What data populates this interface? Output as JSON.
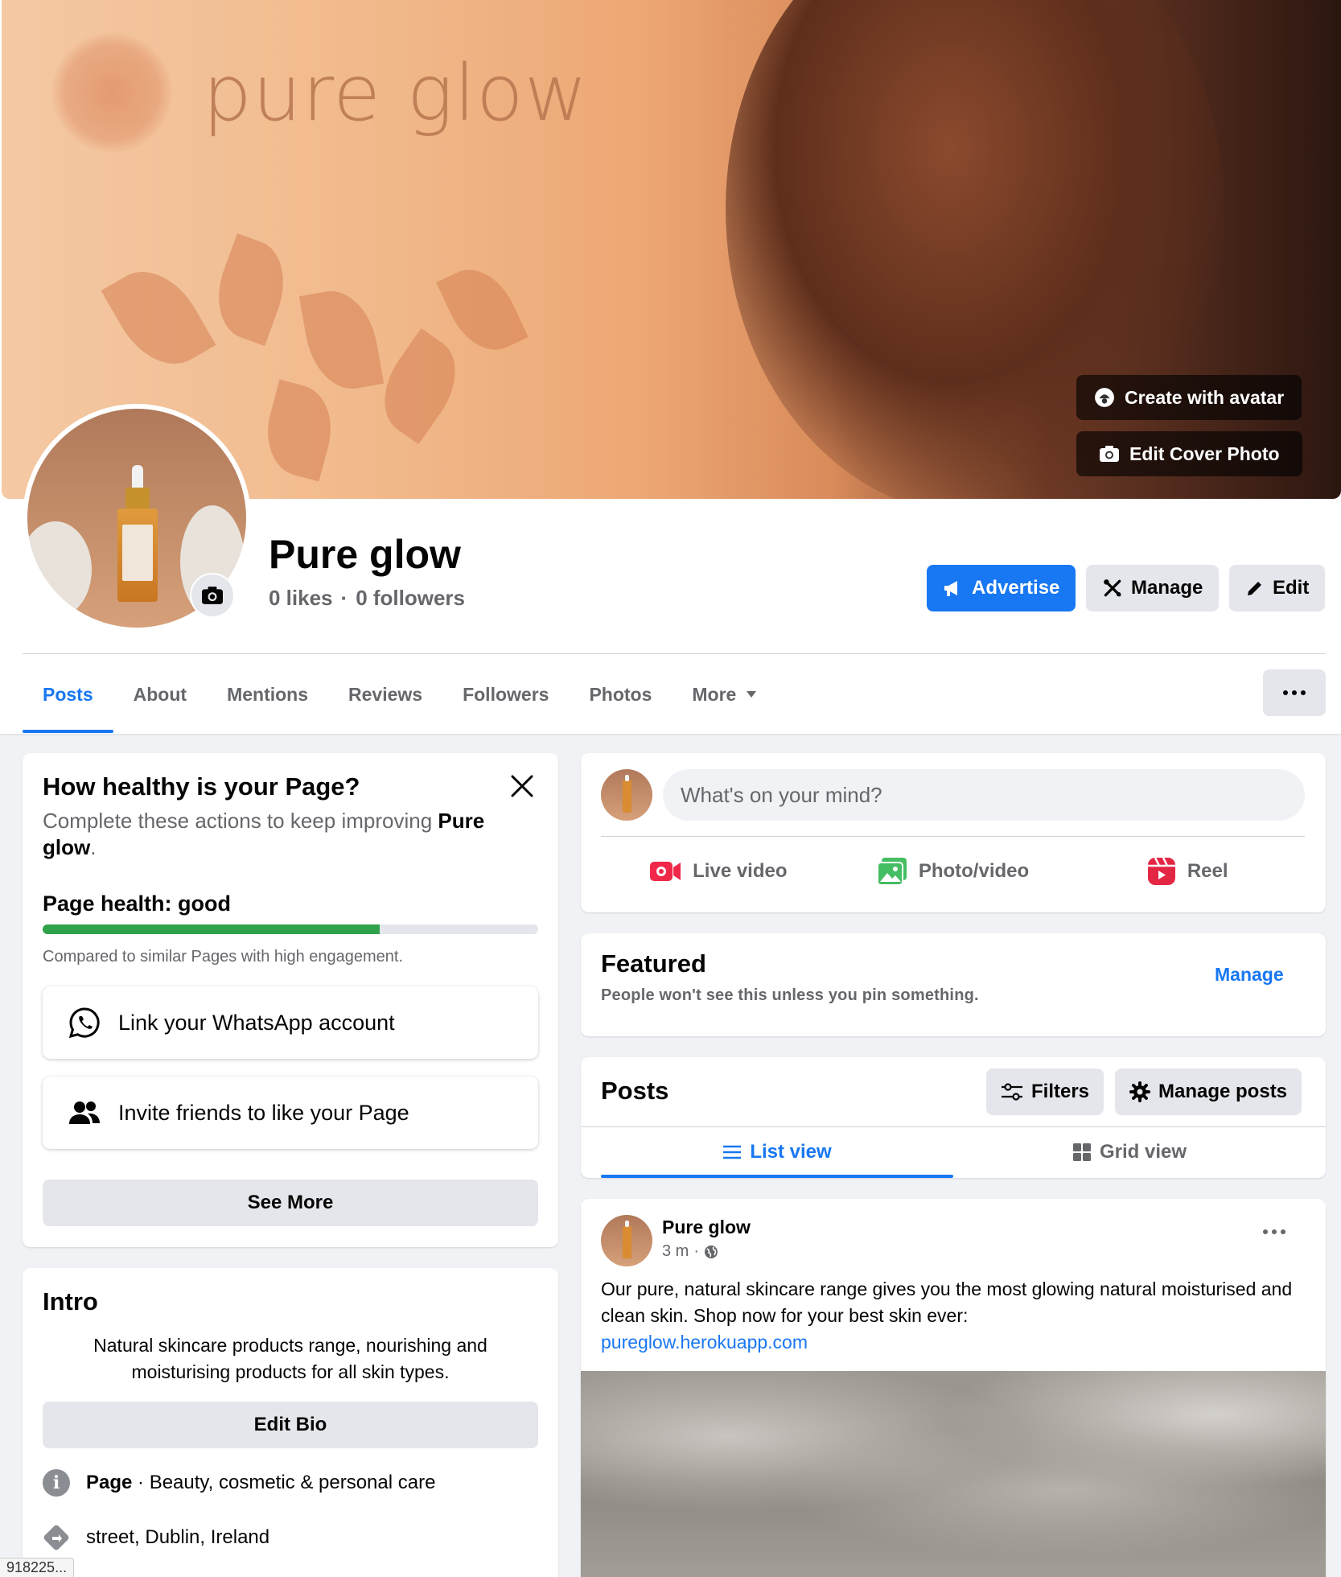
{
  "cover": {
    "brand_text": "pure glow",
    "create_avatar_label": "Create with avatar",
    "edit_cover_label": "Edit Cover Photo"
  },
  "profile": {
    "name": "Pure glow",
    "likes": "0 likes",
    "separator": "·",
    "followers": "0 followers"
  },
  "actions": {
    "advertise": "Advertise",
    "manage": "Manage",
    "edit": "Edit"
  },
  "tabs": [
    {
      "label": "Posts",
      "active": true
    },
    {
      "label": "About"
    },
    {
      "label": "Mentions"
    },
    {
      "label": "Reviews"
    },
    {
      "label": "Followers"
    },
    {
      "label": "Photos"
    },
    {
      "label": "More"
    }
  ],
  "health": {
    "title": "How healthy is your Page?",
    "desc_prefix": "Complete these actions to keep improving ",
    "desc_name": "Pure glow",
    "desc_suffix": ".",
    "label": "Page health: good",
    "progress_fraction": 0.68,
    "note": "Compared to similar Pages with high engagement.",
    "tasks": [
      {
        "label": "Link your WhatsApp account",
        "icon": "whatsapp-icon"
      },
      {
        "label": "Invite friends to like your Page",
        "icon": "people-icon"
      }
    ],
    "see_more": "See More"
  },
  "intro": {
    "title": "Intro",
    "bio": "Natural skincare products range, nourishing and moisturising products for all skin types.",
    "edit_bio": "Edit Bio",
    "category_label": "Page",
    "category_sep": " · ",
    "category": "Beauty, cosmetic & personal care",
    "address": "street, Dublin, Ireland"
  },
  "composer": {
    "placeholder": "What's on your mind?",
    "live": "Live video",
    "photo": "Photo/video",
    "reel": "Reel"
  },
  "featured": {
    "title": "Featured",
    "sub": "People won't see this unless you pin something.",
    "manage": "Manage"
  },
  "posts": {
    "title": "Posts",
    "filters": "Filters",
    "manage_posts": "Manage posts",
    "list_view": "List view",
    "grid_view": "Grid view"
  },
  "post": {
    "author": "Pure glow",
    "time": "3 m",
    "dot": "·",
    "text": "Our pure, natural skincare range gives you the most glowing natural moisturised and clean skin. Shop now for your best skin ever:",
    "link": "pureglow.herokuapp.com"
  },
  "status_bar": {
    "url": "918225..."
  },
  "colors": {
    "accent": "#1877f2",
    "health_good": "#31a24c",
    "live_red": "#f02849",
    "photo_green": "#45bd62",
    "reel_pink": "#e42645"
  }
}
